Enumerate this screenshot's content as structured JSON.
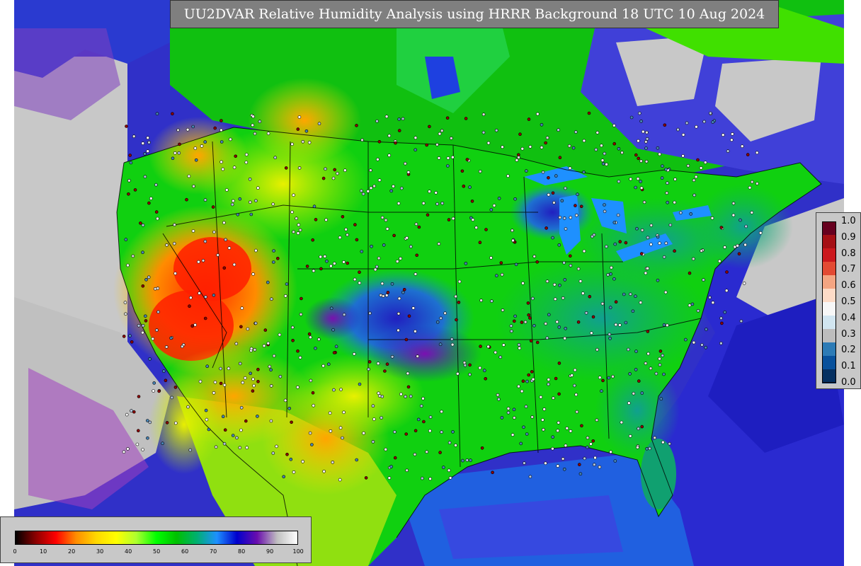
{
  "title": "UU2DVAR Relative Humidity Analysis using HRRR Background 18 UTC 10 Aug 2024",
  "right_colorbar": {
    "labels": [
      "1.0",
      "0.9",
      "0.8",
      "0.7",
      "0.6",
      "0.5",
      "0.4",
      "0.3",
      "0.2",
      "0.1",
      "0.0"
    ],
    "colors": [
      "#67001f",
      "#a50f15",
      "#cb181d",
      "#e34a33",
      "#f4a582",
      "#fddbc7",
      "#f7f7f7",
      "#d1e5f0",
      "#bdbdbd",
      "#2c7bb6",
      "#08519c",
      "#053061"
    ]
  },
  "bottom_colorbar": {
    "ticks": [
      "0",
      "10",
      "20",
      "30",
      "40",
      "50",
      "60",
      "70",
      "80",
      "90",
      "100"
    ],
    "stops": [
      "#000000",
      "#8b0000",
      "#ff0000",
      "#ff8c00",
      "#ffd700",
      "#ffff00",
      "#adff2f",
      "#00ff00",
      "#00c000",
      "#00b070",
      "#1e90ff",
      "#0000cd",
      "#6a0dad",
      "#c0c0c0",
      "#ffffff"
    ]
  }
}
